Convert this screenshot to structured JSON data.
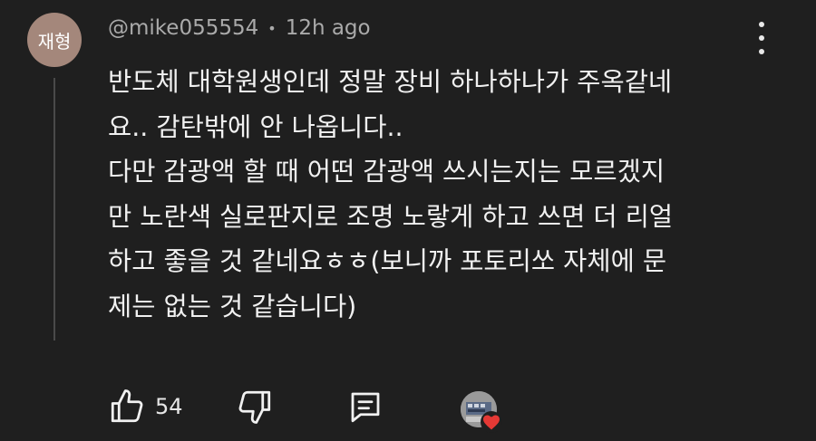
{
  "comment": {
    "avatar_text": "재형",
    "author": "@mike055554",
    "separator": "•",
    "time": "12h ago",
    "lines": [
      "반도체 대학원생인데 정말 장비 하나하나가 주옥같네",
      "요.. 감탄밖에 안 나옵니다..",
      "다만 감광액 할 때 어떤 감광액 쓰시는지는 모르겠지",
      "만 노란색 실로판지로 조명 노랗게 하고 쓰면 더 리얼",
      "하고 좋을 것 같네요ㅎㅎ(보니까 포토리쏘 자체에 문",
      "제는 없는 것 같습니다)"
    ]
  },
  "actions": {
    "like_count": "54",
    "icons": {
      "like": "thumbs-up-icon",
      "dislike": "thumbs-down-icon",
      "reply": "reply-comment-icon",
      "creator_heart": "heart-icon"
    }
  },
  "colors": {
    "background": "#1f1f1f",
    "avatar": "#a4877b",
    "muted_text": "#aaaaaa",
    "heart": "#e53935"
  }
}
